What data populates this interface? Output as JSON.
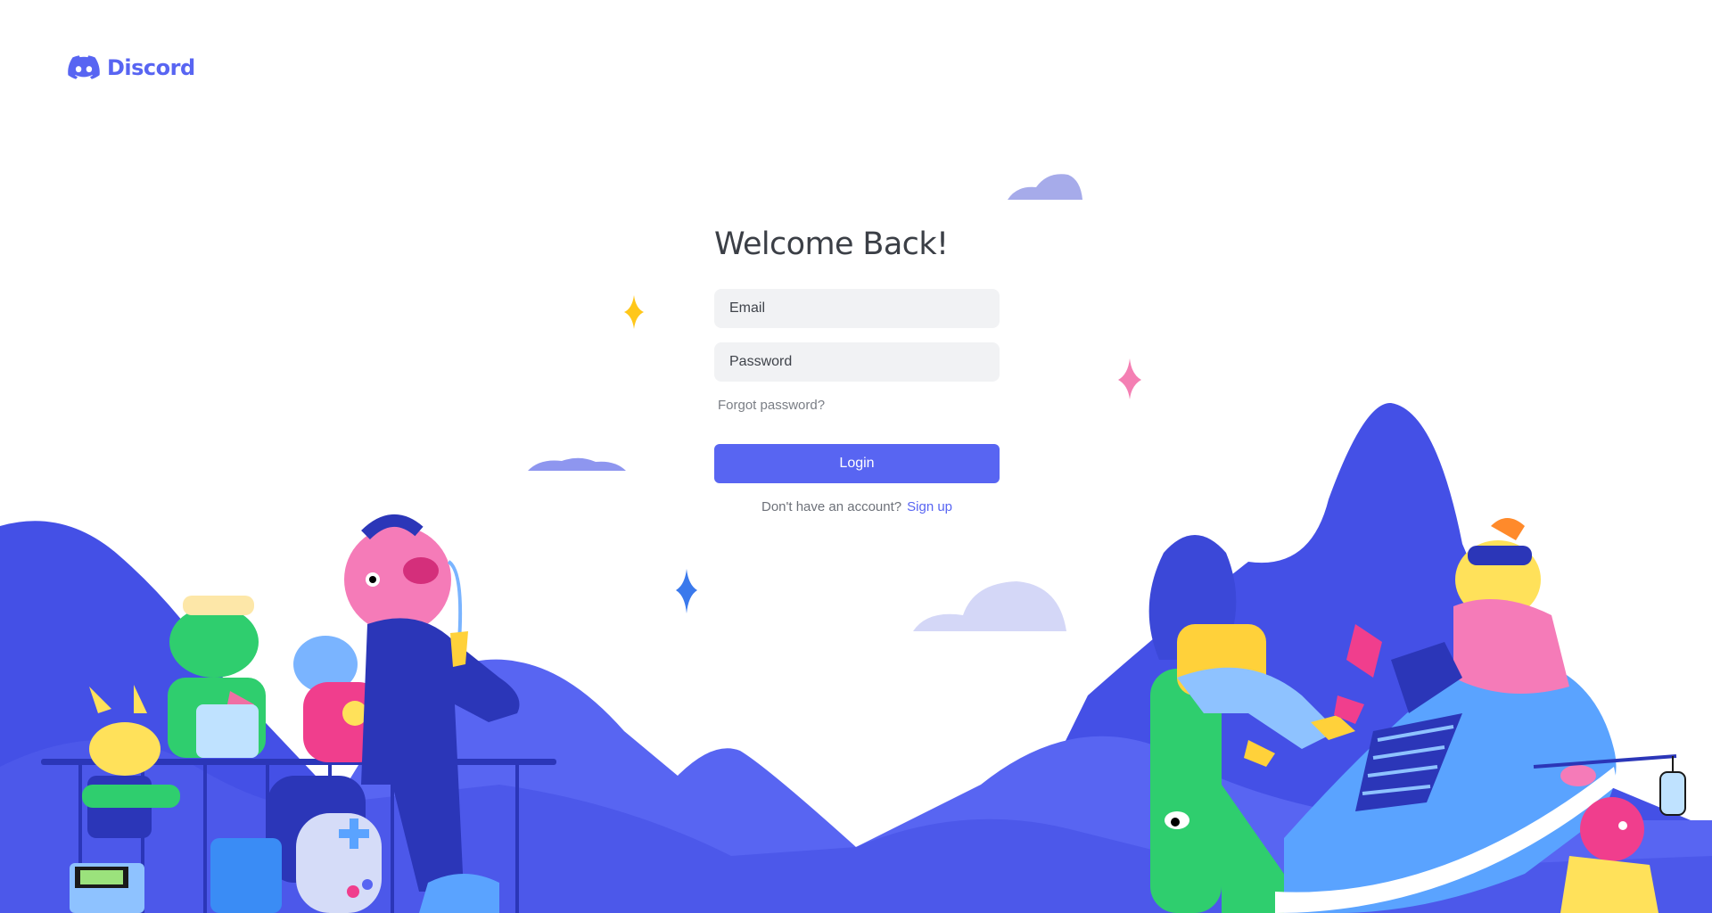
{
  "brand": {
    "name": "Discord",
    "logo_icon": "discord-clyde-icon",
    "color": "#5865f2"
  },
  "login": {
    "title": "Welcome Back!",
    "email_placeholder": "Email",
    "password_placeholder": "Password",
    "forgot_password": "Forgot password?",
    "submit_label": "Login",
    "no_account_text": "Don't have an account?",
    "signup_link": "Sign up"
  },
  "colors": {
    "accent": "#5865f2",
    "mountain_dark": "#4450e6",
    "mountain_light": "#5865f2",
    "field_bg": "#f1f2f4",
    "text_dark": "#3b3f46",
    "text_muted": "#7a7e85"
  },
  "decor": {
    "illustration": "discord-characters-illustration",
    "sparkle_icons": [
      "yellow-sparkle-icon",
      "pink-sparkle-icon",
      "blue-sparkle-icon"
    ],
    "cloud_icons": [
      "cloud-icon"
    ]
  }
}
